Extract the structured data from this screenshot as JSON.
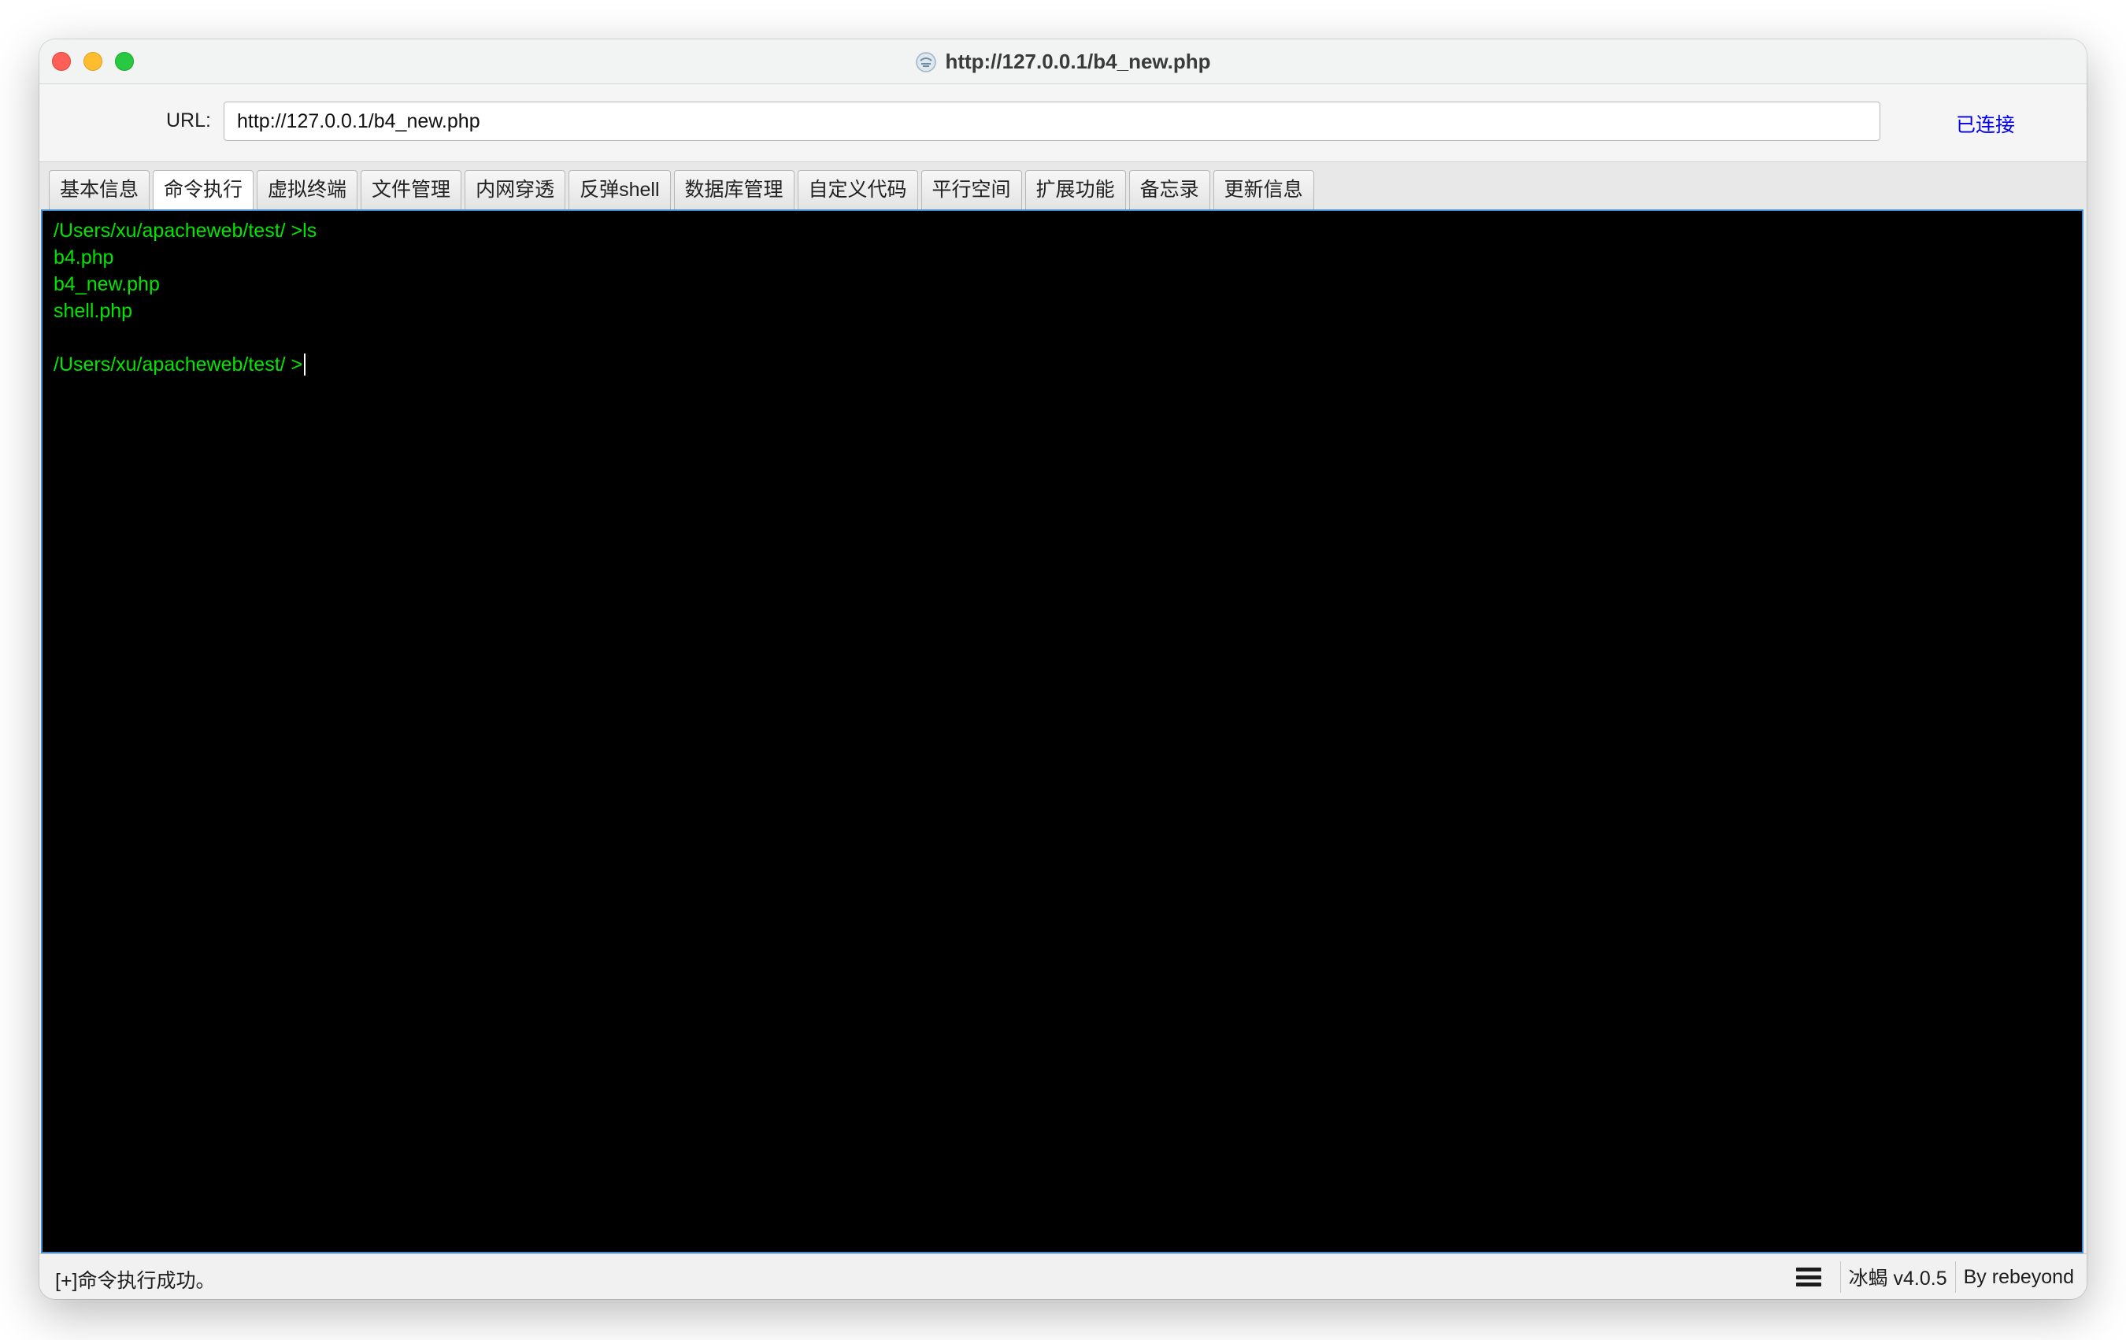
{
  "window": {
    "title": "http://127.0.0.1/b4_new.php",
    "title_icon": "ice-scorpion-icon"
  },
  "url_bar": {
    "label": "URL:",
    "value": "http://127.0.0.1/b4_new.php",
    "connection_status": "已连接"
  },
  "tabs": [
    {
      "label": "基本信息",
      "active": false
    },
    {
      "label": "命令执行",
      "active": true
    },
    {
      "label": "虚拟终端",
      "active": false
    },
    {
      "label": "文件管理",
      "active": false
    },
    {
      "label": "内网穿透",
      "active": false
    },
    {
      "label": "反弹shell",
      "active": false
    },
    {
      "label": "数据库管理",
      "active": false
    },
    {
      "label": "自定义代码",
      "active": false
    },
    {
      "label": "平行空间",
      "active": false
    },
    {
      "label": "扩展功能",
      "active": false
    },
    {
      "label": "备忘录",
      "active": false
    },
    {
      "label": "更新信息",
      "active": false
    }
  ],
  "terminal": {
    "lines": [
      "/Users/xu/apacheweb/test/ >ls",
      "b4.php",
      "b4_new.php",
      "shell.php",
      ""
    ],
    "prompt": "/Users/xu/apacheweb/test/ >",
    "text_color": "#00e600",
    "background": "#000000"
  },
  "status_bar": {
    "message": "[+]命令执行成功。",
    "menu_icon": "menu-lines-icon",
    "version": "冰蝎 v4.0.5",
    "author": "By rebeyond"
  },
  "colors": {
    "close": "#fe5f57",
    "minimize": "#febc2e",
    "maximize": "#28c840",
    "link": "#0000ee",
    "terminal_border": "#3e8ed0"
  }
}
